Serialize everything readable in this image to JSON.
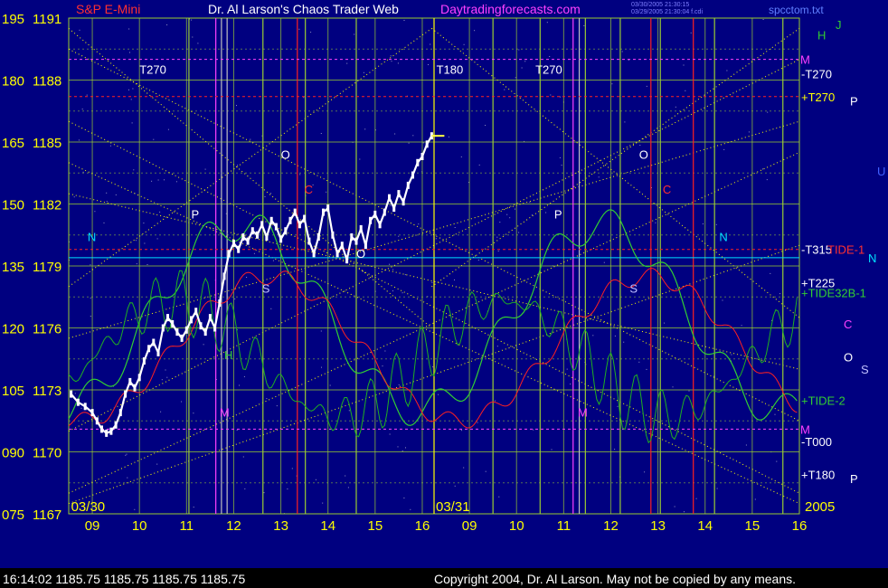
{
  "header": {
    "title_left": "S&P E-Mini",
    "title_main": "Dr. Al Larson's Chaos Trader Web",
    "title_site": "Daytradingforecasts.com",
    "file_name": "spcctom.txt",
    "stamp_line1": "03/30/2005 21:30:15",
    "stamp_line2": "03/29/2005 21:30:04 f.cdi"
  },
  "footer": {
    "quote": "16:14:02  1185.75 1185.75 1185.75 1185.75",
    "copyright": "Copyright 2004, Dr. Al Larson. May not be copied by any means."
  },
  "colors": {
    "background": "#000080",
    "grid": "#9acd32",
    "price": "#ffffff",
    "forecast": "#32cd32",
    "red_line": "#ff2020",
    "yellow": "#ffff00",
    "magenta": "#ff40ff"
  },
  "chart_data": {
    "type": "line",
    "title": "S&P E-Mini",
    "left_axis_a": [
      "195",
      "180",
      "165",
      "150",
      "135",
      "120",
      "105",
      "090",
      "075"
    ],
    "left_axis_b": [
      "1191",
      "1188",
      "1185",
      "1182",
      "1179",
      "1176",
      "1173",
      "1170",
      "1167"
    ],
    "x_ticks": [
      "09",
      "10",
      "11",
      "12",
      "13",
      "14",
      "15",
      "16",
      "09",
      "10",
      "11",
      "12",
      "13",
      "14",
      "15",
      "16"
    ],
    "date_labels": [
      "03/30",
      "03/31"
    ],
    "year_label": "2005",
    "ylim": [
      1167,
      1191
    ],
    "xlim": [
      8.5,
      24.0
    ],
    "right_labels": [
      {
        "text": "J",
        "color": "#32cd32",
        "y": 1190.7
      },
      {
        "text": "H",
        "color": "#32cd32",
        "y": 1190.2
      },
      {
        "text": "M",
        "color": "#ff40ff",
        "y": 1189.0
      },
      {
        "text": "-T270",
        "color": "#ffffff",
        "y": 1188.3
      },
      {
        "text": "+T270",
        "color": "#ffff00",
        "y": 1187.2
      },
      {
        "text": "P",
        "color": "#ffffff",
        "y": 1187.0
      },
      {
        "text": "U",
        "color": "#4060ff",
        "y": 1183.6
      },
      {
        "text": "-T315",
        "color": "#ffffff",
        "y": 1179.8
      },
      {
        "text": "TIDE-1",
        "color": "#ff3030",
        "y": 1179.8
      },
      {
        "text": "N",
        "color": "#00e0ff",
        "y": 1179.4
      },
      {
        "text": "+T225",
        "color": "#ffffff",
        "y": 1178.2
      },
      {
        "text": "+TIDE32B-1",
        "color": "#32cd32",
        "y": 1177.7
      },
      {
        "text": "C",
        "color": "#ff40ff",
        "y": 1176.2
      },
      {
        "text": "O",
        "color": "#ffffff",
        "y": 1174.6
      },
      {
        "text": "S",
        "color": "#c0c0ff",
        "y": 1174.0
      },
      {
        "text": "+TIDE-2",
        "color": "#32cd32",
        "y": 1172.5
      },
      {
        "text": "M",
        "color": "#ff40ff",
        "y": 1171.1
      },
      {
        "text": "-T000",
        "color": "#ffffff",
        "y": 1170.5
      },
      {
        "text": "+T180",
        "color": "#ffffff",
        "y": 1168.9
      },
      {
        "text": "P",
        "color": "#ffffff",
        "y": 1168.7
      }
    ],
    "plot_labels": [
      {
        "text": "T270",
        "x": 10.0,
        "y": 1188.3,
        "color": "#ffffff"
      },
      {
        "text": "T180",
        "x": 16.3,
        "y": 1188.3,
        "color": "#ffffff"
      },
      {
        "text": "T270",
        "x": 18.4,
        "y": 1188.3,
        "color": "#ffffff"
      },
      {
        "text": "N",
        "x": 8.9,
        "y": 1180.2,
        "color": "#00e0ff"
      },
      {
        "text": "P",
        "x": 11.1,
        "y": 1181.3,
        "color": "#ffffff"
      },
      {
        "text": "S",
        "x": 12.6,
        "y": 1177.7,
        "color": "#c0c0ff"
      },
      {
        "text": "H",
        "x": 11.8,
        "y": 1174.5,
        "color": "#32cd32"
      },
      {
        "text": "M",
        "x": 11.7,
        "y": 1171.7,
        "color": "#ff40ff"
      },
      {
        "text": "O",
        "x": 13.0,
        "y": 1184.2,
        "color": "#ffffff"
      },
      {
        "text": "C",
        "x": 13.5,
        "y": 1182.5,
        "color": "#ff3030"
      },
      {
        "text": "O",
        "x": 14.6,
        "y": 1179.4,
        "color": "#ffffff"
      },
      {
        "text": "P",
        "x": 18.8,
        "y": 1181.3,
        "color": "#ffffff"
      },
      {
        "text": "S",
        "x": 20.4,
        "y": 1177.7,
        "color": "#c0c0ff"
      },
      {
        "text": "O",
        "x": 20.6,
        "y": 1184.2,
        "color": "#ffffff"
      },
      {
        "text": "C",
        "x": 21.1,
        "y": 1182.5,
        "color": "#ff3030"
      },
      {
        "text": "N",
        "x": 22.3,
        "y": 1180.2,
        "color": "#00e0ff"
      },
      {
        "text": "M",
        "x": 19.3,
        "y": 1171.7,
        "color": "#ff40ff"
      }
    ],
    "v_lines": [
      {
        "x": 11.05,
        "color": "#9acd32"
      },
      {
        "x": 11.62,
        "color": "#ff40ff"
      },
      {
        "x": 11.74,
        "color": "#c0c0c0"
      },
      {
        "x": 11.86,
        "color": "#c0c0c0"
      },
      {
        "x": 12.62,
        "color": "#9acd32"
      },
      {
        "x": 13.35,
        "color": "#ff2020"
      },
      {
        "x": 13.52,
        "color": "#9acd32"
      },
      {
        "x": 14.6,
        "color": "#9acd32"
      },
      {
        "x": 16.25,
        "color": "#ffff00"
      },
      {
        "x": 17.5,
        "color": "#9acd32"
      },
      {
        "x": 18.5,
        "color": "#9acd32"
      },
      {
        "x": 19.2,
        "color": "#ff40ff"
      },
      {
        "x": 19.33,
        "color": "#c0c0c0"
      },
      {
        "x": 19.46,
        "color": "#9acd32"
      },
      {
        "x": 20.2,
        "color": "#9acd32"
      },
      {
        "x": 20.85,
        "color": "#ff2020"
      },
      {
        "x": 21.05,
        "color": "#9acd32"
      },
      {
        "x": 21.75,
        "color": "#ff2020"
      },
      {
        "x": 22.2,
        "color": "#9acd32"
      },
      {
        "x": 23.65,
        "color": "#9acd32"
      }
    ],
    "h_lines": [
      {
        "y": 1189.0,
        "color": "#ff40ff",
        "style": "dash"
      },
      {
        "y": 1187.2,
        "color": "#ff2020",
        "style": "dash"
      },
      {
        "y": 1179.8,
        "color": "#ff2020",
        "style": "dash"
      },
      {
        "y": 1171.1,
        "color": "#ff40ff",
        "style": "dash"
      },
      {
        "y": 1179.4,
        "color": "#00e0ff",
        "style": "solid"
      }
    ],
    "series": [
      {
        "name": "S&P E-Mini",
        "color": "#ffffff",
        "x": [
          8.55,
          8.7,
          8.85,
          9.0,
          9.1,
          9.2,
          9.3,
          9.4,
          9.5,
          9.6,
          9.7,
          9.8,
          9.9,
          10.0,
          10.1,
          10.2,
          10.3,
          10.4,
          10.5,
          10.6,
          10.7,
          10.8,
          10.9,
          11.0,
          11.1,
          11.2,
          11.3,
          11.4,
          11.5,
          11.6,
          11.7,
          11.8,
          11.9,
          12.0,
          12.1,
          12.2,
          12.3,
          12.4,
          12.5,
          12.6,
          12.7,
          12.8,
          12.9,
          13.0,
          13.1,
          13.2,
          13.3,
          13.4,
          13.5,
          13.6,
          13.7,
          13.8,
          13.9,
          14.0,
          14.1,
          14.2,
          14.3,
          14.4,
          14.5,
          14.6,
          14.7,
          14.8,
          14.9,
          15.0,
          15.1,
          15.2,
          15.3,
          15.4,
          15.5,
          15.6,
          15.7,
          15.8,
          15.9,
          16.0,
          16.1,
          16.2
        ],
        "y": [
          1172.8,
          1172.4,
          1172.2,
          1171.9,
          1171.5,
          1171.1,
          1170.9,
          1171.0,
          1171.3,
          1171.9,
          1172.8,
          1173.4,
          1173.1,
          1173.6,
          1174.4,
          1175.0,
          1175.3,
          1174.8,
          1176.0,
          1176.5,
          1176.2,
          1175.8,
          1175.5,
          1175.9,
          1176.4,
          1176.8,
          1176.1,
          1175.8,
          1176.5,
          1176.0,
          1177.2,
          1178.5,
          1179.6,
          1180.1,
          1179.8,
          1180.4,
          1180.2,
          1180.7,
          1180.5,
          1181.0,
          1180.4,
          1181.2,
          1180.9,
          1180.3,
          1180.7,
          1181.2,
          1181.6,
          1181.0,
          1181.3,
          1180.2,
          1179.6,
          1180.4,
          1181.6,
          1181.8,
          1180.5,
          1179.6,
          1180.0,
          1179.3,
          1180.4,
          1180.2,
          1180.8,
          1180.0,
          1181.2,
          1181.5,
          1181.0,
          1181.6,
          1182.3,
          1181.8,
          1182.5,
          1182.1,
          1182.9,
          1183.4,
          1184.0,
          1184.3,
          1184.9,
          1185.3
        ]
      }
    ]
  }
}
